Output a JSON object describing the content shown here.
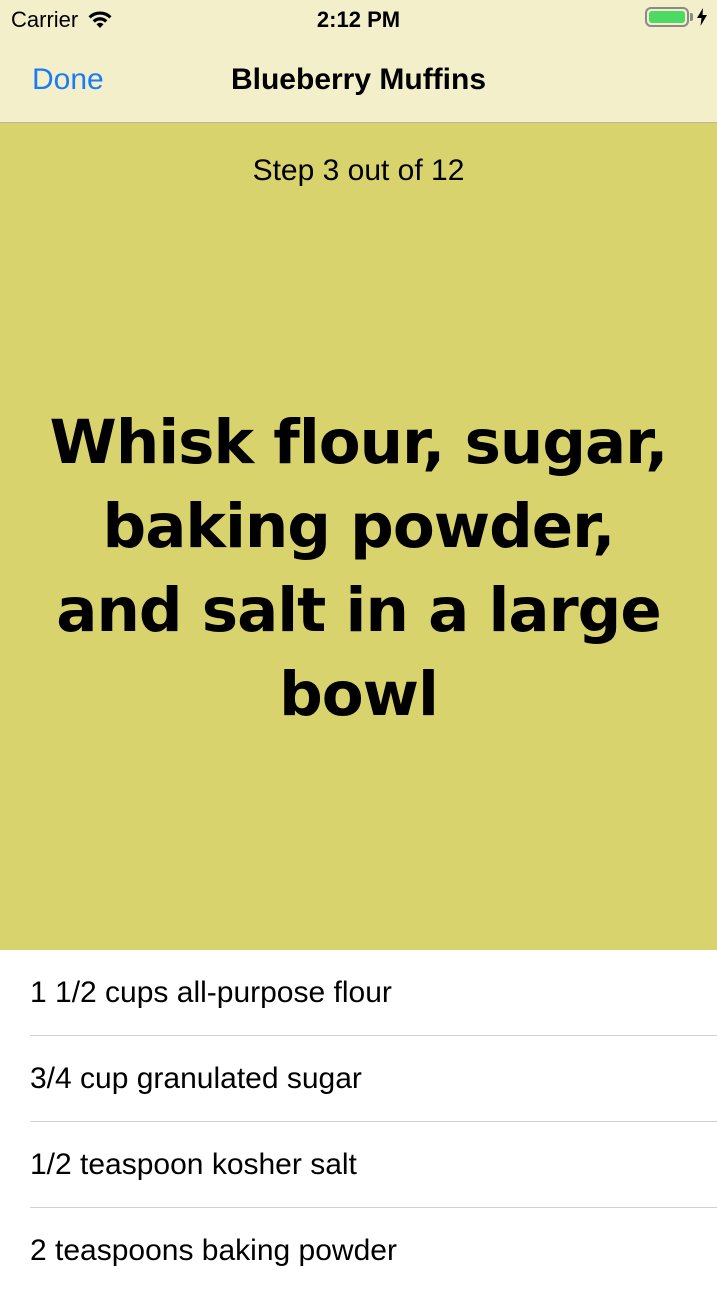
{
  "status_bar": {
    "carrier": "Carrier",
    "time": "2:12 PM",
    "battery_color": "#4cd964"
  },
  "nav_bar": {
    "done_label": "Done",
    "title": "Blueberry Muffins",
    "accent_color": "#1a7cf5",
    "background_color": "#f2efca"
  },
  "step": {
    "counter": "Step 3 out of 12",
    "instruction": "Whisk flour, sugar, baking powder, and salt in a large bowl",
    "background_color": "#d8d36d"
  },
  "ingredients": [
    "1 1/2 cups all-purpose flour",
    "3/4 cup granulated sugar",
    "1/2 teaspoon kosher salt",
    "2 teaspoons baking powder"
  ],
  "icons": [
    "wifi-icon",
    "battery-icon",
    "charging-bolt-icon"
  ]
}
